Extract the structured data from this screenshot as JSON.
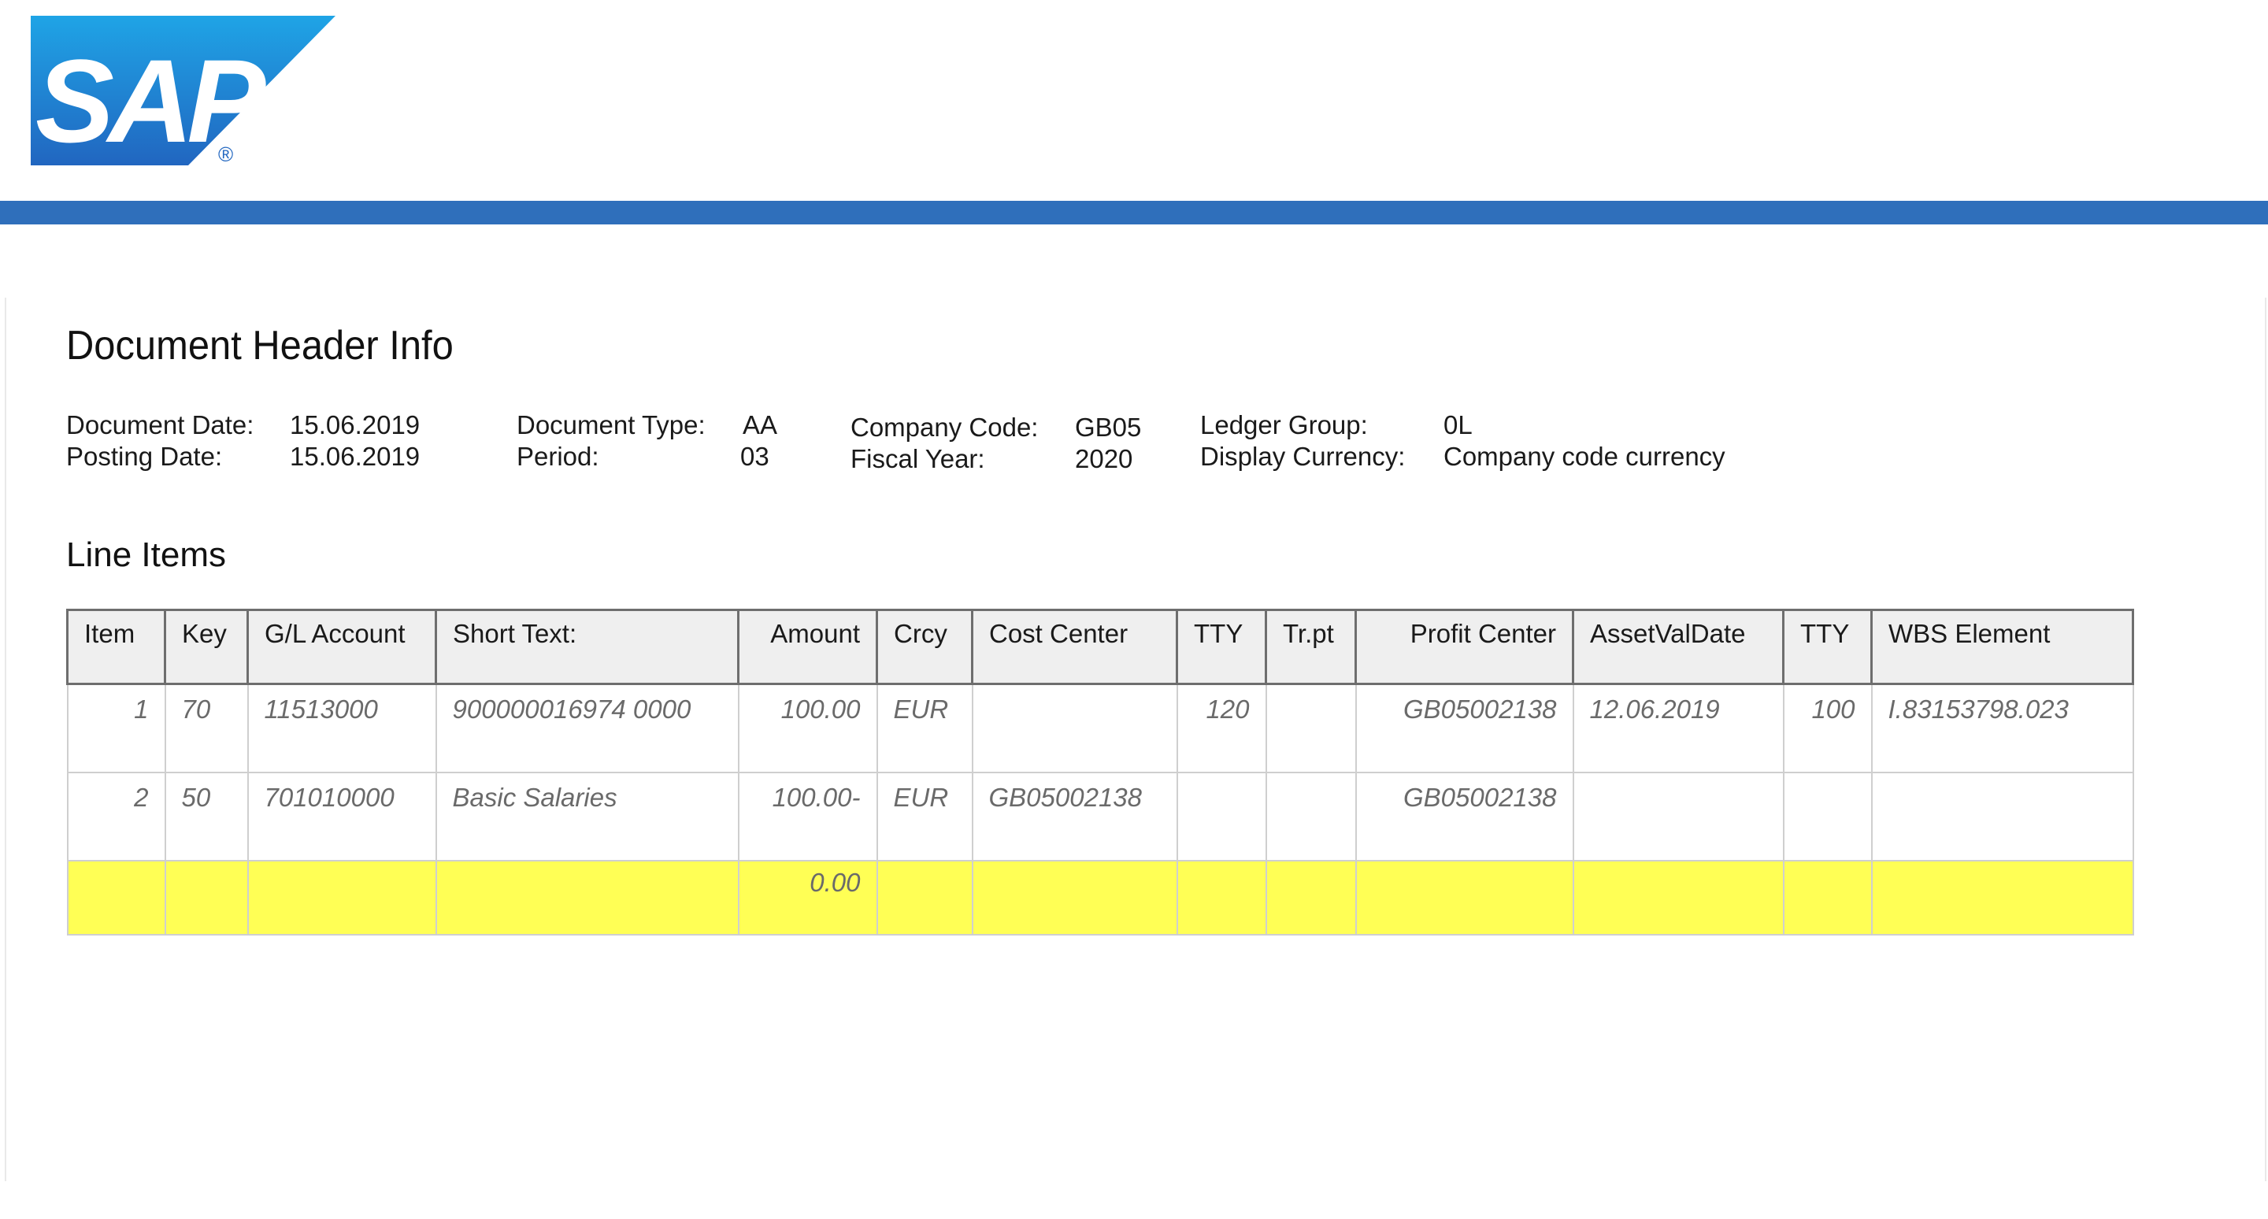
{
  "logo": {
    "text": "SAP",
    "registered": "®"
  },
  "colors": {
    "brand_blue": "#2f6fbb",
    "logo_blue_light": "#1fa4e6",
    "logo_blue_dark": "#2166c0",
    "total_row": "#ffff55"
  },
  "header_section": {
    "title": "Document Header Info",
    "document_date_label": "Document Date:",
    "document_date": "15.06.2019",
    "posting_date_label": "Posting Date:",
    "posting_date": "15.06.2019",
    "document_type_label": "Document Type:",
    "document_type": "AA",
    "period_label": "Period:",
    "period": "03",
    "company_code_label": "Company Code:",
    "company_code": "GB05",
    "fiscal_year_label": "Fiscal Year:",
    "fiscal_year": "2020",
    "ledger_group_label": "Ledger Group:",
    "ledger_group": "0L",
    "display_currency_label": "Display Currency:",
    "display_currency": "Company code currency"
  },
  "line_items": {
    "title": "Line Items",
    "columns": [
      "Item",
      "Key",
      "G/L Account",
      "Short Text:",
      "Amount",
      "Crcy",
      "Cost Center",
      "TTY",
      "Tr.pt",
      "Profit Center",
      "AssetValDate",
      "TTY",
      "WBS Element"
    ],
    "rows": [
      [
        "1",
        "70",
        "11513000",
        "900000016974 0000",
        "100.00",
        "EUR",
        "",
        "120",
        "",
        "GB05002138",
        "12.06.2019",
        "100",
        "I.83153798.023"
      ],
      [
        "2",
        "50",
        "701010000",
        "Basic Salaries",
        "100.00-",
        "EUR",
        "GB05002138",
        "",
        "",
        "GB05002138",
        "",
        "",
        ""
      ]
    ],
    "total_amount": "0.00"
  }
}
